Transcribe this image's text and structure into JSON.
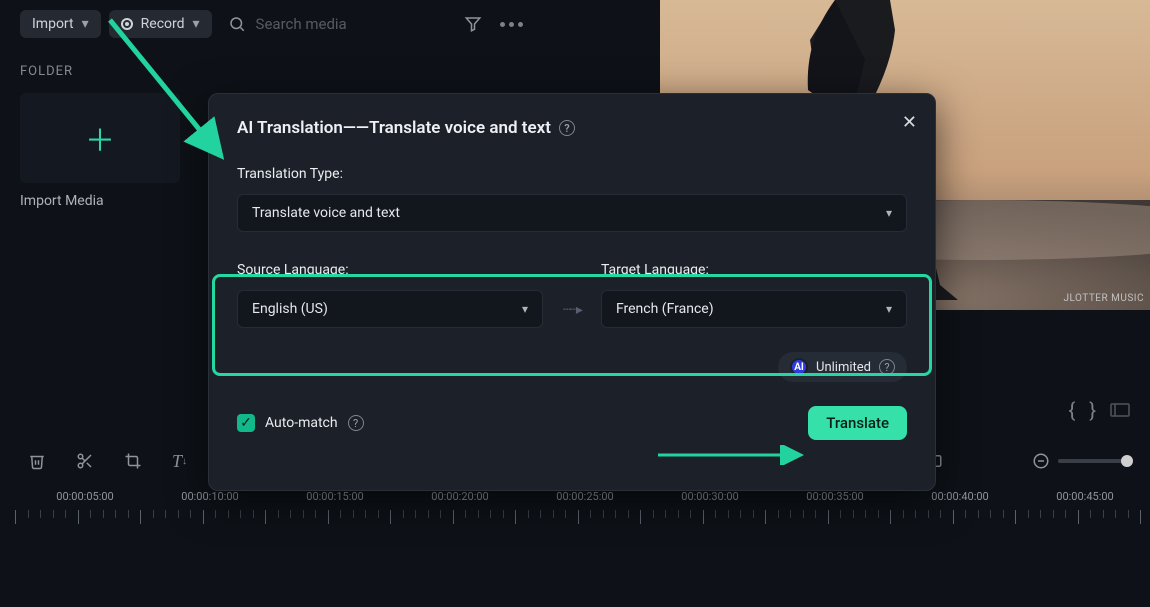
{
  "topbar": {
    "import_label": "Import",
    "record_label": "Record",
    "search_placeholder": "Search media"
  },
  "left": {
    "folder_label": "FOLDER",
    "tile_caption": "Import Media"
  },
  "preview": {
    "watermark": "JLOTTER MUSIC"
  },
  "modal": {
    "title": "AI Translation——Translate voice and text",
    "type_label": "Translation Type:",
    "type_value": "Translate voice and text",
    "source_label": "Source Language:",
    "source_value": "English (US)",
    "target_label": "Target Language:",
    "target_value": "French (France)",
    "unlimited_label": "Unlimited",
    "automatch_label": "Auto-match",
    "translate_btn": "Translate"
  },
  "timeline": {
    "labels": [
      "00:00:05:00",
      "00:00:10:00",
      "00:00:15:00",
      "00:00:20:00",
      "00:00:25:00",
      "00:00:30:00",
      "00:00:35:00",
      "00:00:40:00",
      "00:00:45:00"
    ]
  }
}
